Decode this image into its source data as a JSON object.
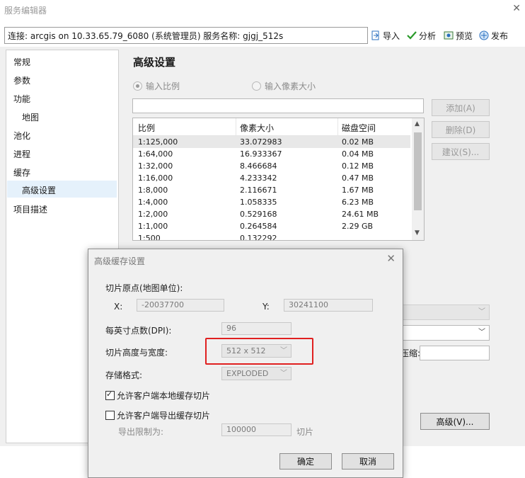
{
  "window": {
    "title": "服务编辑器",
    "close_glyph": "✕"
  },
  "connection": {
    "text": "连接: arcgis on 10.33.65.79_6080 (系统管理员)    服务名称: gjgj_512s"
  },
  "toolbar": {
    "import": "导入",
    "analyze": "分析",
    "preview": "预览",
    "publish": "发布"
  },
  "sidebar": {
    "items": [
      {
        "label": "常规"
      },
      {
        "label": "参数"
      },
      {
        "label": "功能"
      },
      {
        "label": "地图"
      },
      {
        "label": "池化"
      },
      {
        "label": "进程"
      },
      {
        "label": "缓存"
      },
      {
        "label": "高级设置"
      },
      {
        "label": "项目描述"
      }
    ]
  },
  "main": {
    "title": "高级设置",
    "radio_scale": "输入比例",
    "radio_pixel": "输入像素大小",
    "add_button": "添加(A)",
    "delete_button": "删除(D)",
    "suggest_button": "建议(S)...",
    "columns": [
      "比例",
      "像素大小",
      "磁盘空间"
    ],
    "rows": [
      [
        "1:125,000",
        "33.072983",
        "0.02 MB"
      ],
      [
        "1:64,000",
        "16.933367",
        "0.04 MB"
      ],
      [
        "1:32,000",
        "8.466684",
        "0.12 MB"
      ],
      [
        "1:16,000",
        "4.233342",
        "0.47 MB"
      ],
      [
        "1:8,000",
        "2.116671",
        "1.67 MB"
      ],
      [
        "1:4,000",
        "1.058335",
        "6.23 MB"
      ],
      [
        "1:2,000",
        "0.529168",
        "24.61 MB"
      ],
      [
        "1:1,000",
        "0.264584",
        "2.29 GB"
      ],
      [
        "1:500",
        "0.132292",
        ""
      ]
    ],
    "compress_label": "压缩:",
    "advanced_button": "高级(V)..."
  },
  "dialog": {
    "title": "高级缓存设置",
    "close_glyph": "✕",
    "origin_label": "切片原点(地图单位):",
    "x_label": "X:",
    "x_value": "-20037700",
    "y_label": "Y:",
    "y_value": "30241100",
    "dpi_label": "每英寸点数(DPI):",
    "dpi_value": "96",
    "tile_size_label": "切片高度与宽度:",
    "tile_size_value": "512 x 512",
    "format_label": "存储格式:",
    "format_value": "EXPLODED",
    "allow_local_cache": "允许客户端本地缓存切片",
    "allow_local_cache_checked": true,
    "allow_export_cache": "允许客户端导出缓存切片",
    "allow_export_cache_checked": false,
    "export_limit_label": "导出限制为:",
    "export_limit_value": "100000",
    "export_limit_unit": "切片",
    "ok_button": "确定",
    "cancel_button": "取消"
  },
  "colors": {
    "highlight": "#e02020",
    "selection": "#e5f1fb"
  }
}
